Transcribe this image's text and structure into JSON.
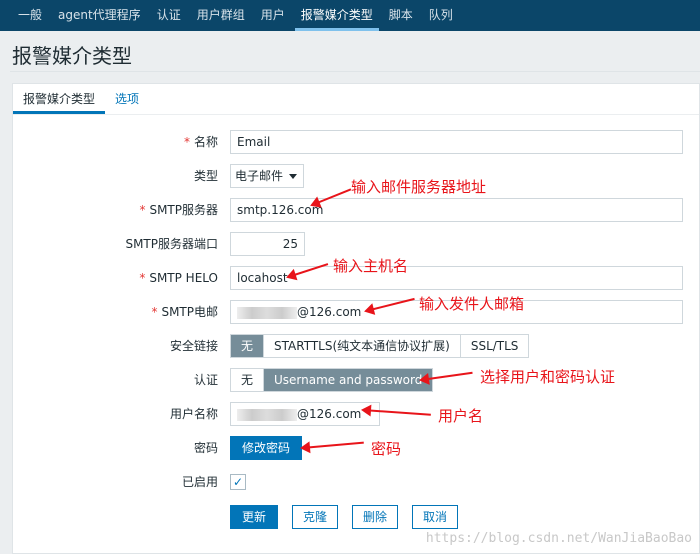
{
  "nav": [
    "一般",
    "agent代理程序",
    "认证",
    "用户群组",
    "用户",
    "报警媒介类型",
    "脚本",
    "队列"
  ],
  "nav_active": 5,
  "page_title": "报警媒介类型",
  "tabs": [
    "报警媒介类型",
    "选项"
  ],
  "form": {
    "name": {
      "label": "名称",
      "value": "Email"
    },
    "type": {
      "label": "类型",
      "value": "电子邮件"
    },
    "smtp_server": {
      "label": "SMTP服务器",
      "value": "smtp.126.com"
    },
    "smtp_port": {
      "label": "SMTP服务器端口",
      "value": "25"
    },
    "smtp_helo": {
      "label": "SMTP HELO",
      "value": "locahost"
    },
    "smtp_email": {
      "label": "SMTP电邮",
      "value": "@126.com"
    },
    "security": {
      "label": "安全链接",
      "options": [
        "无",
        "STARTTLS(纯文本通信协议扩展)",
        "SSL/TLS"
      ],
      "selected": "无"
    },
    "auth": {
      "label": "认证",
      "options": [
        "无",
        "Username and password"
      ],
      "selected": "Username and password"
    },
    "username": {
      "label": "用户名称",
      "value": "@126.com"
    },
    "password": {
      "label": "密码",
      "button": "修改密码"
    },
    "enabled": {
      "label": "已启用",
      "checked": true
    }
  },
  "buttons": {
    "update": "更新",
    "clone": "克隆",
    "delete": "删除",
    "cancel": "取消"
  },
  "annotations": [
    "输入邮件服务器地址",
    "输入主机名",
    "输入发件人邮箱",
    "选择用户和密码认证",
    "用户名",
    "密码"
  ],
  "watermark": "https://blog.csdn.net/WanJiaBaoBao",
  "colors": {
    "nav": "#0b4669",
    "accent": "#0275b8",
    "segment_on": "#768d99",
    "annotation": "#e8141a"
  }
}
